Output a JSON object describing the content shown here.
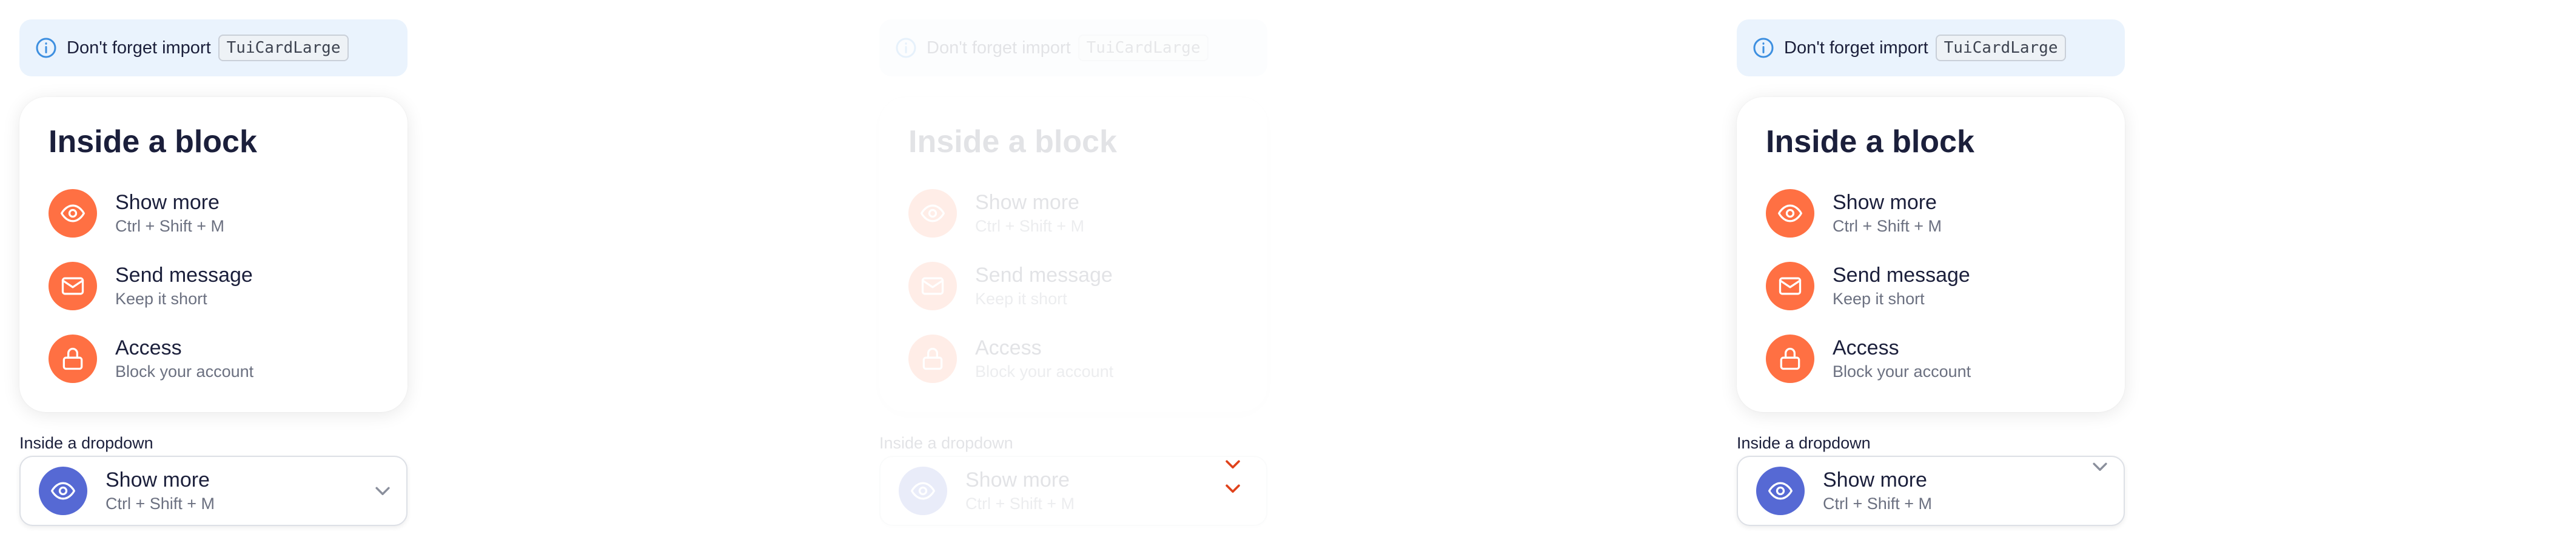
{
  "panels": [
    {
      "notice": {
        "text": "Don't forget import",
        "code": "TuiCardLarge"
      },
      "card": {
        "title": "Inside a block",
        "items": [
          {
            "title": "Show more",
            "subtitle": "Ctrl + Shift + M",
            "icon": "eye-icon"
          },
          {
            "title": "Send message",
            "subtitle": "Keep it short",
            "icon": "mail-icon"
          },
          {
            "title": "Access",
            "subtitle": "Block your account",
            "icon": "lock-icon"
          }
        ]
      },
      "dropdown": {
        "label": "Inside a dropdown",
        "selected": {
          "title": "Show more",
          "subtitle": "Ctrl + Shift + M",
          "icon": "eye-icon"
        },
        "chevron": "chevron-down-icon"
      }
    },
    {
      "notice": {
        "text": "Don't forget import",
        "code": "TuiCardLarge"
      },
      "card": {
        "title": "Inside a block",
        "items": [
          {
            "title": "Show more",
            "subtitle": "Ctrl + Shift + M",
            "icon": "eye-icon"
          },
          {
            "title": "Send message",
            "subtitle": "Keep it short",
            "icon": "mail-icon"
          },
          {
            "title": "Access",
            "subtitle": "Block your account",
            "icon": "lock-icon"
          }
        ]
      },
      "dropdown": {
        "label": "Inside a dropdown",
        "selected": {
          "title": "Show more",
          "subtitle": "Ctrl + Shift + M",
          "icon": "eye-icon"
        },
        "chevron": "chevron-down-icon"
      }
    },
    {
      "notice": {
        "text": "Don't forget import",
        "code": "TuiCardLarge"
      },
      "card": {
        "title": "Inside a block",
        "items": [
          {
            "title": "Show more",
            "subtitle": "Ctrl + Shift + M",
            "icon": "eye-icon"
          },
          {
            "title": "Send message",
            "subtitle": "Keep it short",
            "icon": "mail-icon"
          },
          {
            "title": "Access",
            "subtitle": "Block your account",
            "icon": "lock-icon"
          }
        ]
      },
      "dropdown": {
        "label": "Inside a dropdown",
        "selected": {
          "title": "Show more",
          "subtitle": "Ctrl + Shift + M",
          "icon": "eye-icon"
        },
        "chevron": "chevron-down-icon"
      }
    }
  ],
  "colors": {
    "accent": "#ff7043",
    "dropdown_icon": "#5669d4",
    "notice_bg": "#eaf3fd",
    "info_icon": "#3d8fe0",
    "chevron_disabled": "#e0421b"
  }
}
